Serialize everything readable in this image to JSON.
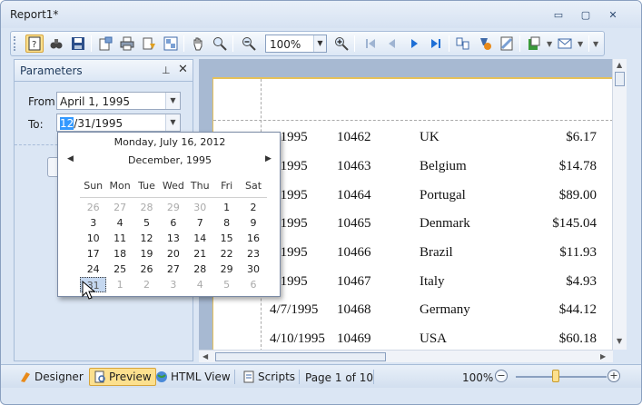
{
  "window": {
    "title": "Report1*",
    "controls": {
      "minimize": "▭",
      "restore": "▢",
      "close": "✕"
    }
  },
  "toolbar": {
    "zoom_value": "100%"
  },
  "parameters": {
    "title": "Parameters",
    "pin": "⊥",
    "close": "✕",
    "from_label": "From:",
    "from_value": "April 1, 1995",
    "to_label": "To:",
    "to_value_selected": "12",
    "to_value_rest": "/31/1995"
  },
  "calendar": {
    "today": "Monday, July 16, 2012",
    "month": "December, 1995",
    "prev": "◀",
    "next": "▶",
    "days": [
      "Sun",
      "Mon",
      "Tue",
      "Wed",
      "Thu",
      "Fri",
      "Sat"
    ],
    "weeks": [
      [
        "26",
        "27",
        "28",
        "29",
        "30",
        "1",
        "2"
      ],
      [
        "3",
        "4",
        "5",
        "6",
        "7",
        "8",
        "9"
      ],
      [
        "10",
        "11",
        "12",
        "13",
        "14",
        "15",
        "16"
      ],
      [
        "17",
        "18",
        "19",
        "20",
        "21",
        "22",
        "23"
      ],
      [
        "24",
        "25",
        "26",
        "27",
        "28",
        "29",
        "30"
      ],
      [
        "31",
        "1",
        "2",
        "3",
        "4",
        "5",
        "6"
      ]
    ],
    "other_month_cells": [
      [
        0,
        0
      ],
      [
        0,
        1
      ],
      [
        0,
        2
      ],
      [
        0,
        3
      ],
      [
        0,
        4
      ],
      [
        5,
        1
      ],
      [
        5,
        2
      ],
      [
        5,
        3
      ],
      [
        5,
        4
      ],
      [
        5,
        5
      ],
      [
        5,
        6
      ]
    ],
    "selected_cell": [
      5,
      0
    ]
  },
  "report": {
    "rows": [
      {
        "date": "3/1995",
        "order": "10462",
        "country": "UK",
        "amount": "$6.17"
      },
      {
        "date": "4/1995",
        "order": "10463",
        "country": "Belgium",
        "amount": "$14.78"
      },
      {
        "date": "4/1995",
        "order": "10464",
        "country": "Portugal",
        "amount": "$89.00"
      },
      {
        "date": "5/1995",
        "order": "10465",
        "country": "Denmark",
        "amount": "$145.04"
      },
      {
        "date": "6/1995",
        "order": "10466",
        "country": "Brazil",
        "amount": "$11.93"
      },
      {
        "date": "6/1995",
        "order": "10467",
        "country": "Italy",
        "amount": "$4.93"
      },
      {
        "date": "4/7/1995",
        "order": "10468",
        "country": "Germany",
        "amount": "$44.12"
      },
      {
        "date": "4/10/1995",
        "order": "10469",
        "country": "USA",
        "amount": "$60.18"
      }
    ]
  },
  "statusbar": {
    "designer": "Designer",
    "preview": "Preview",
    "html_view": "HTML View",
    "scripts": "Scripts",
    "page_info": "Page 1 of 10",
    "zoom": "100%",
    "zoom_out": "−",
    "zoom_in": "+"
  }
}
